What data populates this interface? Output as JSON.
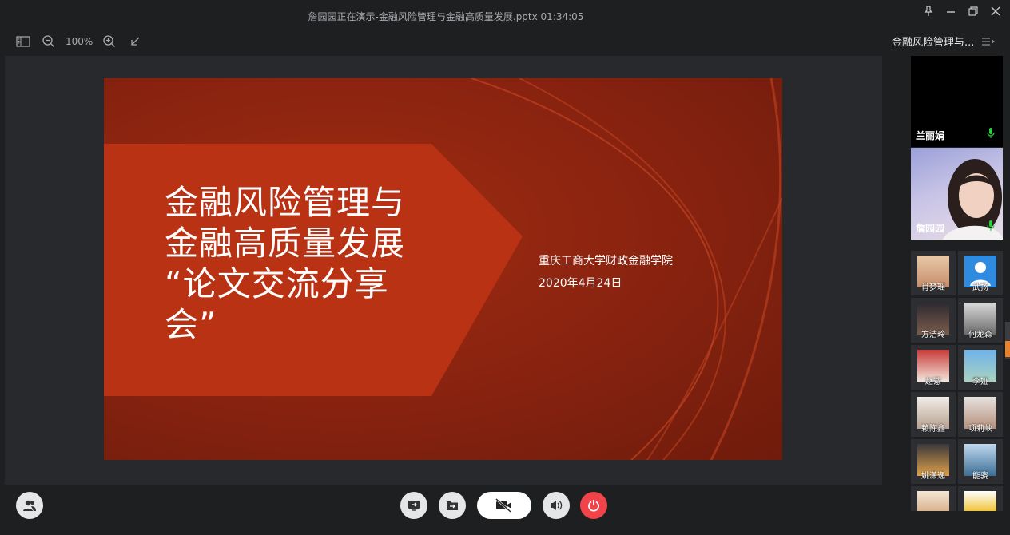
{
  "window": {
    "title": "詹园园正在演示-金融风险管理与金融高质量发展.pptx 01:34:05"
  },
  "toolbar": {
    "zoom": "100%"
  },
  "slide": {
    "title_lines": [
      "金融风险管理与",
      "金融高质量发展",
      "“论文交流分享",
      "会”"
    ],
    "org": "重庆工商大学财政金融学院",
    "date": "2020年4月24日"
  },
  "sidebar": {
    "meeting_name": "金融风险管理与...",
    "videos": [
      {
        "name": "兰丽娟"
      },
      {
        "name": "詹园园"
      }
    ],
    "attendees": [
      {
        "name": "肖梦瑶"
      },
      {
        "name": "武扬"
      },
      {
        "name": "方洁玲"
      },
      {
        "name": "何龙森"
      },
      {
        "name": "赵薏"
      },
      {
        "name": "李娅"
      },
      {
        "name": "赖陈鑫"
      },
      {
        "name": "项莉峡"
      },
      {
        "name": "姚潇逸"
      },
      {
        "name": "能骁"
      },
      {
        "name": ""
      },
      {
        "name": ""
      }
    ]
  },
  "colors": {
    "slide_red": "#8c2410",
    "banner": "#b93214",
    "hangup": "#f0434a",
    "mic_green": "#2ecc40"
  }
}
